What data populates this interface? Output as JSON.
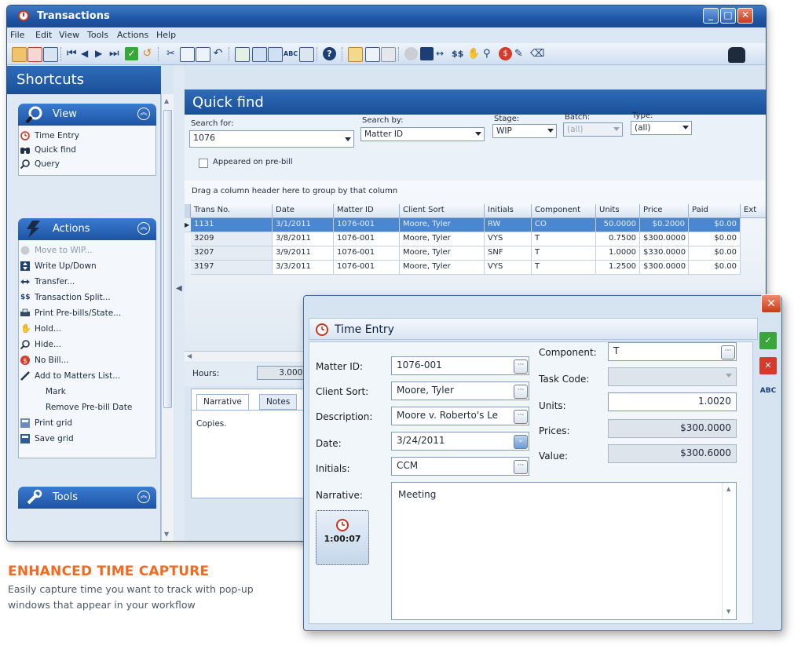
{
  "main_window": {
    "title": "Transactions",
    "menu": [
      "File",
      "Edit",
      "View",
      "Tools",
      "Actions",
      "Help"
    ]
  },
  "sidebar": {
    "title": "Shortcuts",
    "groups": {
      "view": {
        "label": "View",
        "items": [
          "Time Entry",
          "Quick find",
          "Query"
        ]
      },
      "actions": {
        "label": "Actions",
        "items": [
          "Move to WIP...",
          "Write Up/Down",
          "Transfer...",
          "Transaction Split...",
          "Print Pre-bills/State...",
          "Hold...",
          "Hide...",
          "No Bill...",
          "Add to Matters List...",
          "Mark",
          "Remove Pre-bill Date",
          "Print grid",
          "Save grid"
        ]
      },
      "tools": {
        "label": "Tools"
      }
    }
  },
  "quick_find": {
    "title": "Quick find",
    "search_for_label": "Search for:",
    "search_for_value": "1076",
    "search_by_label": "Search by:",
    "search_by_value": "Matter ID",
    "stage_label": "Stage:",
    "stage_value": "WIP",
    "batch_label": "Batch:",
    "batch_value": "(all)",
    "type_label": "Type:",
    "type_value": "(all)",
    "appeared_label": "Appeared on pre-bill",
    "group_by_hint": "Drag a column header here to group by that column"
  },
  "grid": {
    "columns": [
      "Trans No.",
      "Date",
      "Matter ID",
      "Client Sort",
      "Initials",
      "Component",
      "Units",
      "Price",
      "Paid",
      "Ext"
    ],
    "rows": [
      [
        "1131",
        "3/1/2011",
        "1076-001",
        "Moore, Tyler",
        "RW",
        "CO",
        "50.0000",
        "$0.2000",
        "$0.00"
      ],
      [
        "3209",
        "3/8/2011",
        "1076-001",
        "Moore, Tyler",
        "VYS",
        "T",
        "0.7500",
        "$300.0000",
        "$0.00"
      ],
      [
        "3207",
        "3/9/2011",
        "1076-001",
        "Moore, Tyler",
        "SNF",
        "T",
        "1.0000",
        "$330.0000",
        "$0.00"
      ],
      [
        "3197",
        "3/3/2011",
        "1076-001",
        "Moore, Tyler",
        "VYS",
        "T",
        "1.2500",
        "$300.0000",
        "$0.00"
      ]
    ]
  },
  "hours": {
    "label": "Hours:",
    "value": "3.0000"
  },
  "notes": {
    "tabs": [
      "Narrative",
      "Notes"
    ],
    "text": "Copies."
  },
  "time_entry": {
    "title": "Time Entry",
    "matter_id_label": "Matter ID:",
    "matter_id_value": "1076-001",
    "client_sort_label": "Client Sort:",
    "client_sort_value": "Moore, Tyler",
    "description_label": "Description:",
    "description_value": "Moore v. Roberto's Le",
    "date_label": "Date:",
    "date_value": "3/24/2011",
    "initials_label": "Initials:",
    "initials_value": "CCM",
    "narrative_label": "Narrative:",
    "narrative_value": "Meeting",
    "timer_value": "1:00:07",
    "component_label": "Component:",
    "component_value": "T",
    "task_code_label": "Task Code:",
    "task_code_value": "",
    "units_label": "Units:",
    "units_value": "1.0020",
    "prices_label": "Prices:",
    "prices_value": "$300.0000",
    "value_label": "Value:",
    "value_value": "$300.6000"
  },
  "marketing": {
    "title": "ENHANCED TIME CAPTURE",
    "text": "Easily capture time you want to track with pop-up windows that appear in your workflow"
  },
  "colors": {
    "accent_blue": "#1f56a6",
    "selection": "#4b86d1",
    "marketing_orange": "#f26a21",
    "close_red": "#cc3a1c",
    "ok_green": "#3aa53a"
  },
  "icons": [
    "app-clock-icon",
    "binoculars-icon",
    "clock-icon",
    "magnifier-icon",
    "lightning-icon",
    "wrench-icon",
    "checkmark-icon",
    "x-icon",
    "spellcheck-icon"
  ]
}
